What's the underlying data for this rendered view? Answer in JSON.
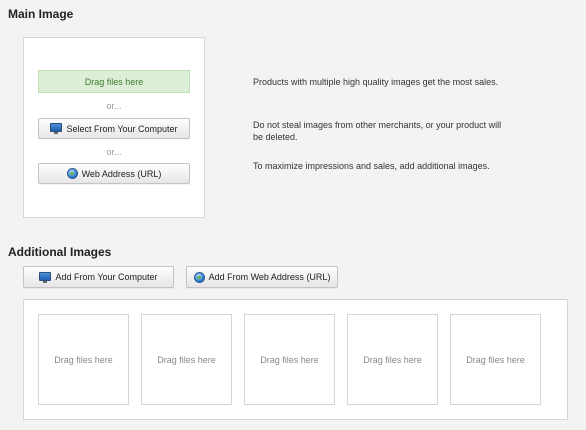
{
  "main": {
    "title": "Main Image",
    "dropzone_label": "Drag files here",
    "or1": "or...",
    "or2": "or...",
    "select_computer_label": "Select From Your Computer",
    "web_address_label": "Web Address (URL)",
    "tips": [
      "Products with multiple high quality images get the most sales.",
      "Do not steal images from other merchants, or your product will be deleted.",
      "To maximize impressions and sales, add additional images."
    ]
  },
  "additional": {
    "title": "Additional Images",
    "add_computer_label": "Add From Your Computer",
    "add_web_label": "Add From Web Address (URL)",
    "slots": [
      "Drag files here",
      "Drag files here",
      "Drag files here",
      "Drag files here",
      "Drag files here"
    ]
  },
  "icons": {
    "computer": "monitor-icon",
    "web": "globe-icon"
  },
  "colors": {
    "dropzone_bg": "#dcefd6",
    "dropzone_text": "#3e7d2e"
  }
}
